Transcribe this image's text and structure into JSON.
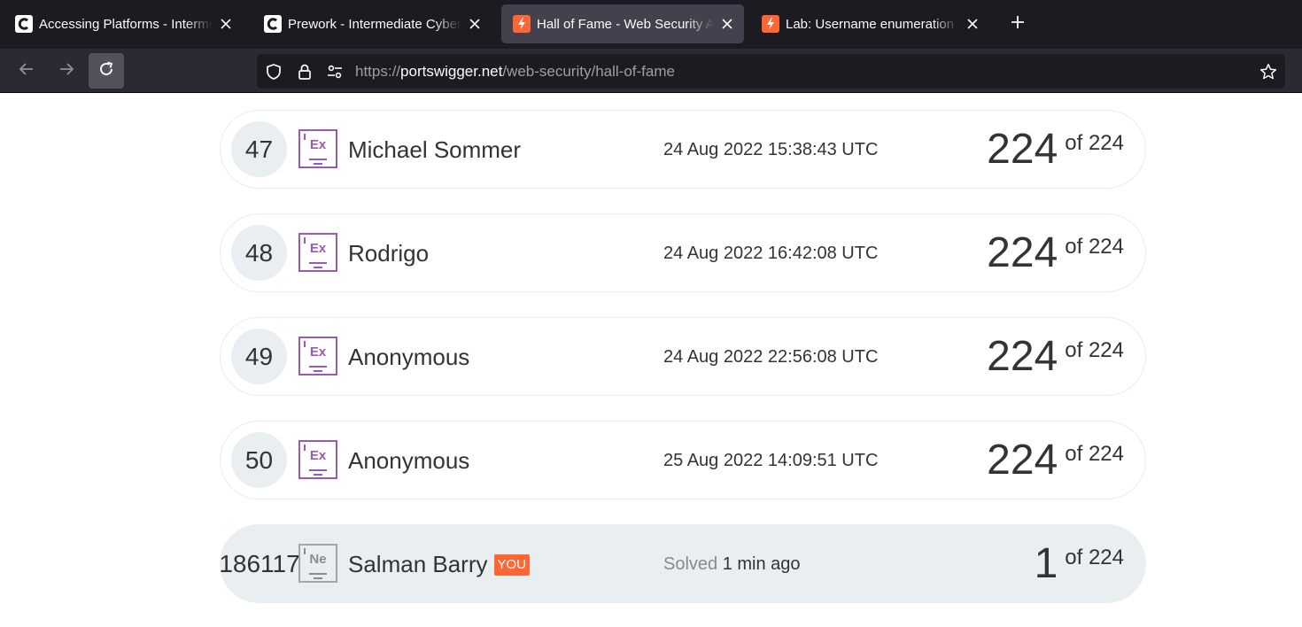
{
  "browser": {
    "tabs": [
      {
        "title": "Accessing Platforms - Intermediate",
        "favicon": "c-logo-icon",
        "active": false
      },
      {
        "title": "Prework - Intermediate Cybersecurity",
        "favicon": "c-logo-icon",
        "active": false
      },
      {
        "title": "Hall of Fame - Web Security Academy",
        "favicon": "portswigger-icon",
        "active": true
      },
      {
        "title": "Lab: Username enumeration via",
        "favicon": "portswigger-icon",
        "active": false
      }
    ],
    "new_tab_icon": "plus-icon",
    "address": {
      "scheme": "https://",
      "host": "portswigger.net",
      "path": "/web-security/hall-of-fame"
    },
    "colors": {
      "tabbar_bg": "#1c1b22",
      "toolbar_bg": "#2b2a33",
      "active_tab_bg": "#42414d",
      "brand_orange": "#ff6633"
    }
  },
  "leaderboard": {
    "rows": [
      {
        "rank": "47",
        "badge": "Ex",
        "name": "Michael Sommer",
        "date": "24 Aug 2022 15:38:43 UTC",
        "score": "224",
        "of": "of 224"
      },
      {
        "rank": "48",
        "badge": "Ex",
        "name": "Rodrigo",
        "date": "24 Aug 2022 16:42:08 UTC",
        "score": "224",
        "of": "of 224"
      },
      {
        "rank": "49",
        "badge": "Ex",
        "name": "Anonymous",
        "date": "24 Aug 2022 22:56:08 UTC",
        "score": "224",
        "of": "of 224"
      },
      {
        "rank": "50",
        "badge": "Ex",
        "name": "Anonymous",
        "date": "25 Aug 2022 14:09:51 UTC",
        "score": "224",
        "of": "of 224"
      }
    ],
    "me": {
      "rank": "186117",
      "badge": "Ne",
      "name": "Salman Barry",
      "you_label": "YOU",
      "solved_label": "Solved",
      "solved_time": "1 min ago",
      "score": "1",
      "of": "of 224"
    },
    "colors": {
      "expert_badge": "#9b59b6",
      "novice_badge": "#a5a5a5",
      "highlight_row": "#e9eef1"
    }
  }
}
